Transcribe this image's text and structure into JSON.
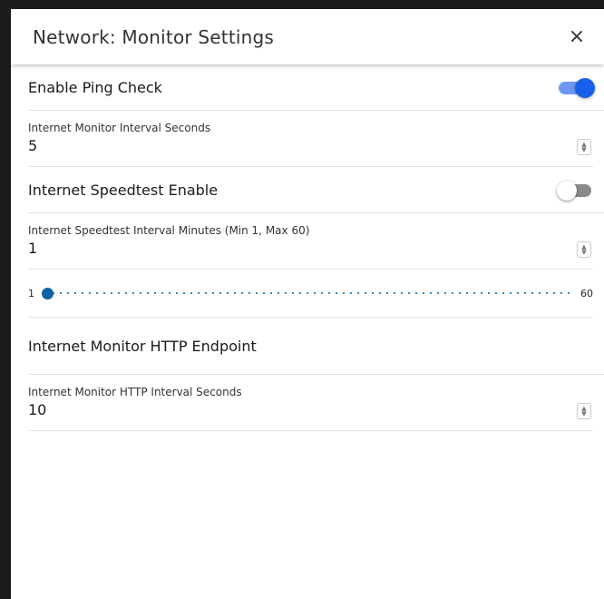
{
  "dialog": {
    "title": "Network: Monitor Settings",
    "close_glyph": "×"
  },
  "settings": {
    "ping_check": {
      "label": "Enable Ping Check",
      "enabled": true
    },
    "monitor_interval": {
      "label": "Internet Monitor Interval Seconds",
      "value": "5"
    },
    "speedtest_enable": {
      "label": "Internet Speedtest Enable",
      "enabled": false
    },
    "speedtest_interval": {
      "label": "Internet Speedtest Interval Minutes (Min 1, Max 60)",
      "value": "1"
    },
    "speedtest_slider": {
      "min": "1",
      "max": "60",
      "value": 1
    },
    "http_endpoint": {
      "label": "Internet Monitor HTTP Endpoint"
    },
    "http_interval": {
      "label": "Internet Monitor HTTP Interval Seconds",
      "value": "10"
    }
  },
  "colors": {
    "toggle_on_thumb": "#1760ea",
    "toggle_on_track": "#6b97f0",
    "slider_accent": "#0d63a5"
  },
  "icons": {
    "close": "close-icon",
    "spinner": "spinner-arrows-icon"
  }
}
